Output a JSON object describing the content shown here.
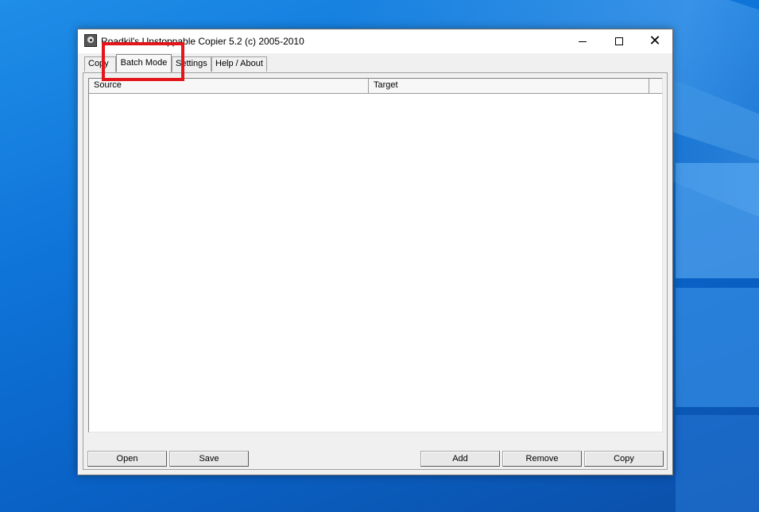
{
  "window": {
    "title": "Roadkil's Unstoppable Copier 5.2 (c) 2005-2010",
    "close_symbol": "✕"
  },
  "tabs": [
    {
      "label": "Copy",
      "active": false
    },
    {
      "label": "Batch Mode",
      "active": true
    },
    {
      "label": "Settings",
      "active": false
    },
    {
      "label": "Help / About",
      "active": false
    }
  ],
  "list": {
    "columns": [
      "Source",
      "Target"
    ],
    "rows": []
  },
  "buttons": {
    "open": "Open",
    "save": "Save",
    "add": "Add",
    "remove": "Remove",
    "copy": "Copy"
  },
  "colors": {
    "highlight": "#e3161b",
    "desktop": "#0f74d8"
  }
}
